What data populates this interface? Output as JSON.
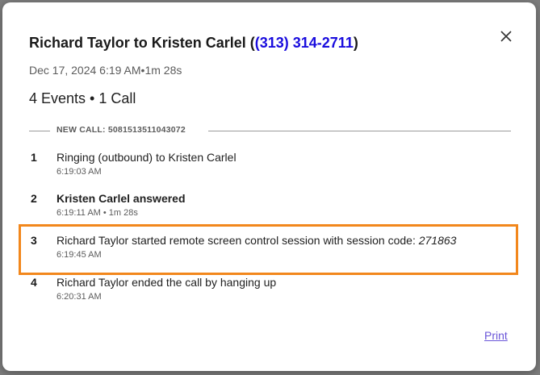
{
  "dialog": {
    "title_prefix": "Richard Taylor to Kristen Carlel (",
    "title_phone": "(313) 314-2711",
    "title_suffix": ")",
    "subtitle": "Dec 17, 2024 6:19 AM•1m 28s",
    "summary": "4 Events • 1 Call",
    "close_icon": "close-icon",
    "call_label": "NEW CALL: 5081513511043072",
    "events": [
      {
        "num": "1",
        "text": "Ringing (outbound) to Kristen Carlel",
        "time": "6:19:03 AM",
        "bold": false
      },
      {
        "num": "2",
        "text": "Kristen Carlel answered",
        "time": "6:19:11 AM • 1m 28s",
        "bold": true
      },
      {
        "num": "3",
        "text": "Richard Taylor started remote screen control session with session code: ",
        "code": "271863",
        "time": "6:19:45 AM",
        "bold": false,
        "highlighted": true
      },
      {
        "num": "4",
        "text": "Richard Taylor ended the call by hanging up",
        "time": "6:20:31 AM",
        "bold": false
      }
    ],
    "print_label": "Print"
  },
  "colors": {
    "phone_link": "#1a0dde",
    "highlight_border": "#f2871c",
    "print_link": "#6a55d8"
  }
}
